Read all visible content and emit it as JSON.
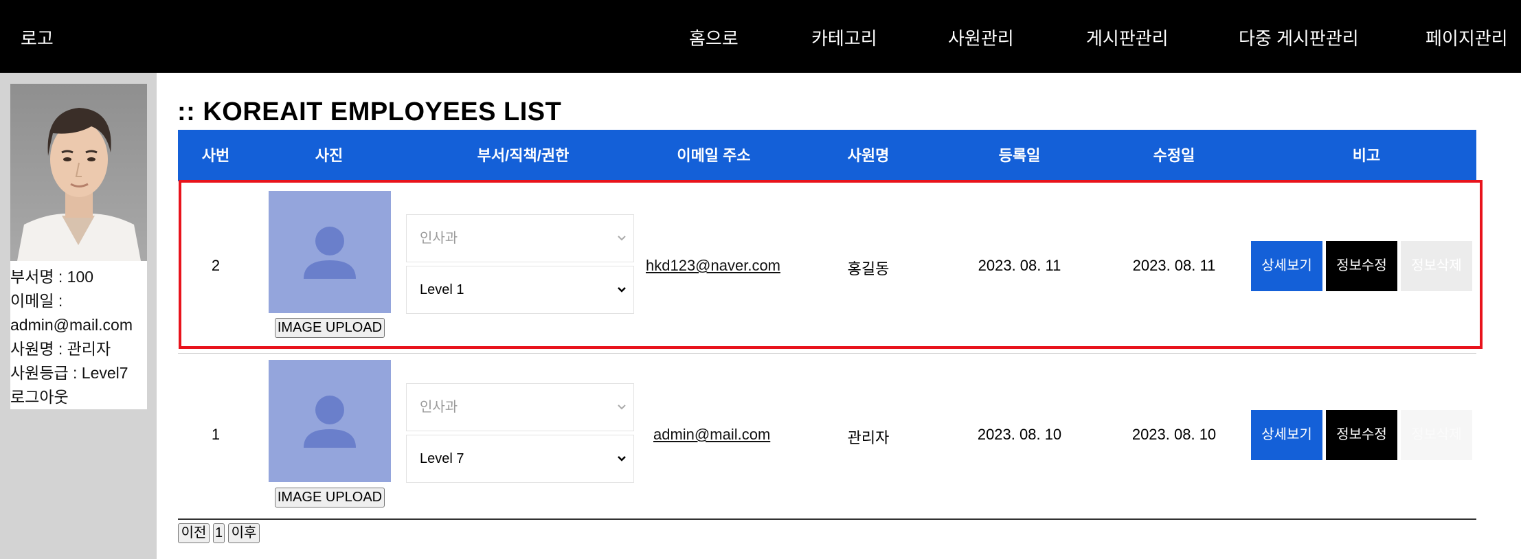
{
  "header": {
    "logo": "로고",
    "nav": [
      "홈으로",
      "카테고리",
      "사원관리",
      "게시판관리",
      "다중 게시판관리",
      "페이지관리"
    ]
  },
  "sidebar": {
    "dept": "부서명 : 100",
    "email_label": "이메일 :",
    "email": "admin@mail.com",
    "name": "사원명 : 관리자",
    "grade": "사원등급 : Level7",
    "logout": "로그아웃"
  },
  "main": {
    "title": ":: KOREAIT EMPLOYEES LIST",
    "columns": [
      "사번",
      "사진",
      "부서/직책/권한",
      "이메일 주소",
      "사원명",
      "등록일",
      "수정일",
      "비고"
    ],
    "rows": [
      {
        "id": "2",
        "upload_label": "IMAGE UPLOAD",
        "dept_select": "인사과",
        "level_select": "Level 1",
        "email": "hkd123@naver.com",
        "name": "홍길동",
        "created": "2023. 08. 11",
        "updated": "2023. 08. 11",
        "btn_detail": "상세보기",
        "btn_edit": "정보수정",
        "btn_delete": "정보삭제"
      },
      {
        "id": "1",
        "upload_label": "IMAGE UPLOAD",
        "dept_select": "인사과",
        "level_select": "Level 7",
        "email": "admin@mail.com",
        "name": "관리자",
        "created": "2023. 08. 10",
        "updated": "2023. 08. 10",
        "btn_detail": "상세보기",
        "btn_edit": "정보수정",
        "btn_delete": "정보삭제"
      }
    ],
    "pagination": {
      "prev": "이전",
      "page": "1",
      "next": "이후"
    }
  },
  "colors": {
    "header_bg": "#000000",
    "table_head_bg": "#1460d8",
    "highlight_border": "#e8131c",
    "avatar_bg": "#94a5dc",
    "avatar_fg": "#6a7fcb",
    "sidebar_bg": "#d3d3d3"
  },
  "icons": [
    "user-avatar-icon",
    "chevron-down-icon"
  ]
}
